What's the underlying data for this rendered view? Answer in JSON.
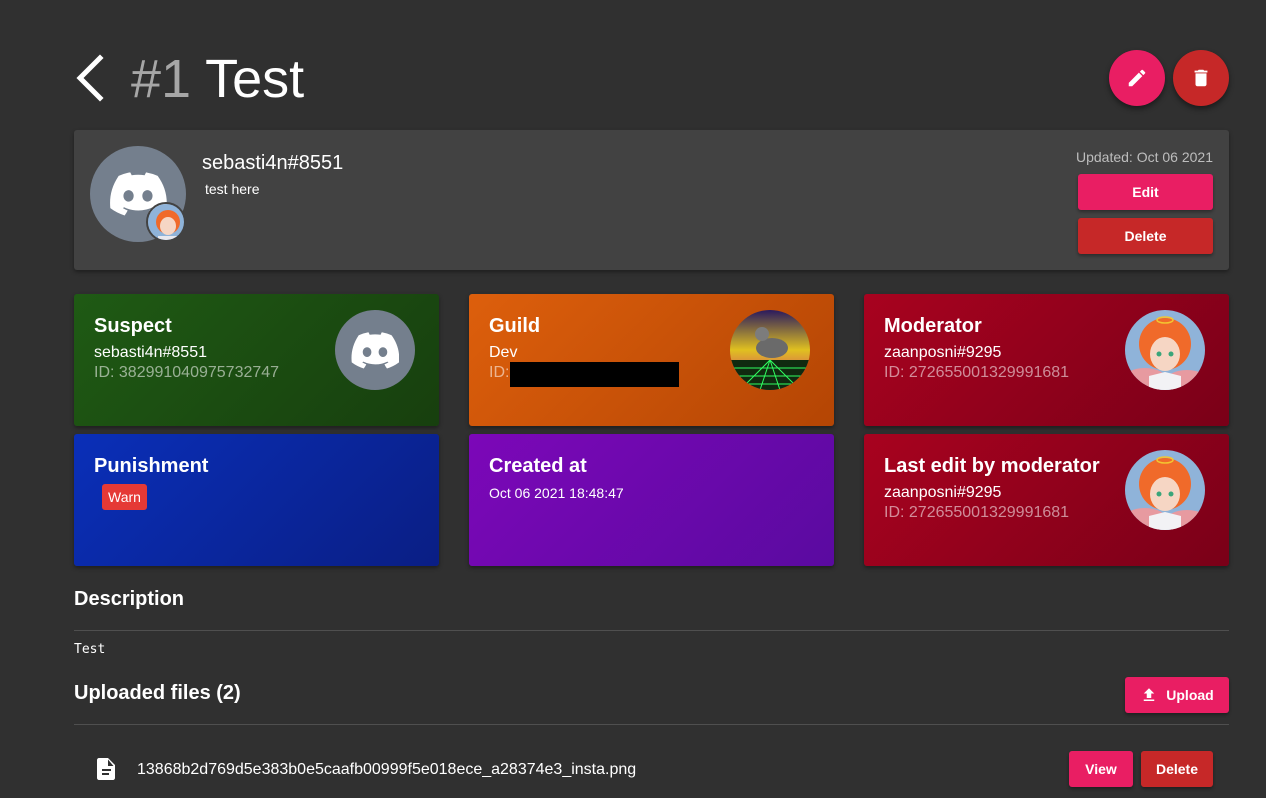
{
  "header": {
    "number": "#1",
    "name": "Test"
  },
  "profile": {
    "name": "sebasti4n#8551",
    "note": "test here",
    "updated": "Updated: Oct 06 2021",
    "edit_label": "Edit",
    "delete_label": "Delete"
  },
  "cards": {
    "suspect": {
      "title": "Suspect",
      "name": "sebasti4n#8551",
      "id": "ID: 382991040975732747"
    },
    "guild": {
      "title": "Guild",
      "name": "Dev",
      "id_label": "ID:"
    },
    "moderator": {
      "title": "Moderator",
      "name": "zaanposni#9295",
      "id": "ID: 272655001329991681"
    },
    "punishment": {
      "title": "Punishment",
      "badge": "Warn"
    },
    "created": {
      "title": "Created at",
      "value": "Oct 06 2021 18:48:47"
    },
    "last_edit": {
      "title": "Last edit by moderator",
      "name": "zaanposni#9295",
      "id": "ID: 272655001329991681"
    }
  },
  "description": {
    "title": "Description",
    "text": "Test"
  },
  "files": {
    "title": "Uploaded files (2)",
    "upload_label": "Upload",
    "items": [
      {
        "name": "13868b2d769d5e383b0e5caafb00999f5e018ece_a28374e3_insta.png",
        "view_label": "View",
        "delete_label": "Delete"
      }
    ]
  },
  "colors": {
    "background": "#303030",
    "surface": "#424242",
    "accent_pink": "#e91e63",
    "accent_red": "#c62828",
    "suspect_card": "#1b5e20",
    "guild_card": "#e65100",
    "moderator_card": "#a0021f",
    "punishment_card": "#0d2bb0",
    "created_card": "#7a05b6"
  }
}
